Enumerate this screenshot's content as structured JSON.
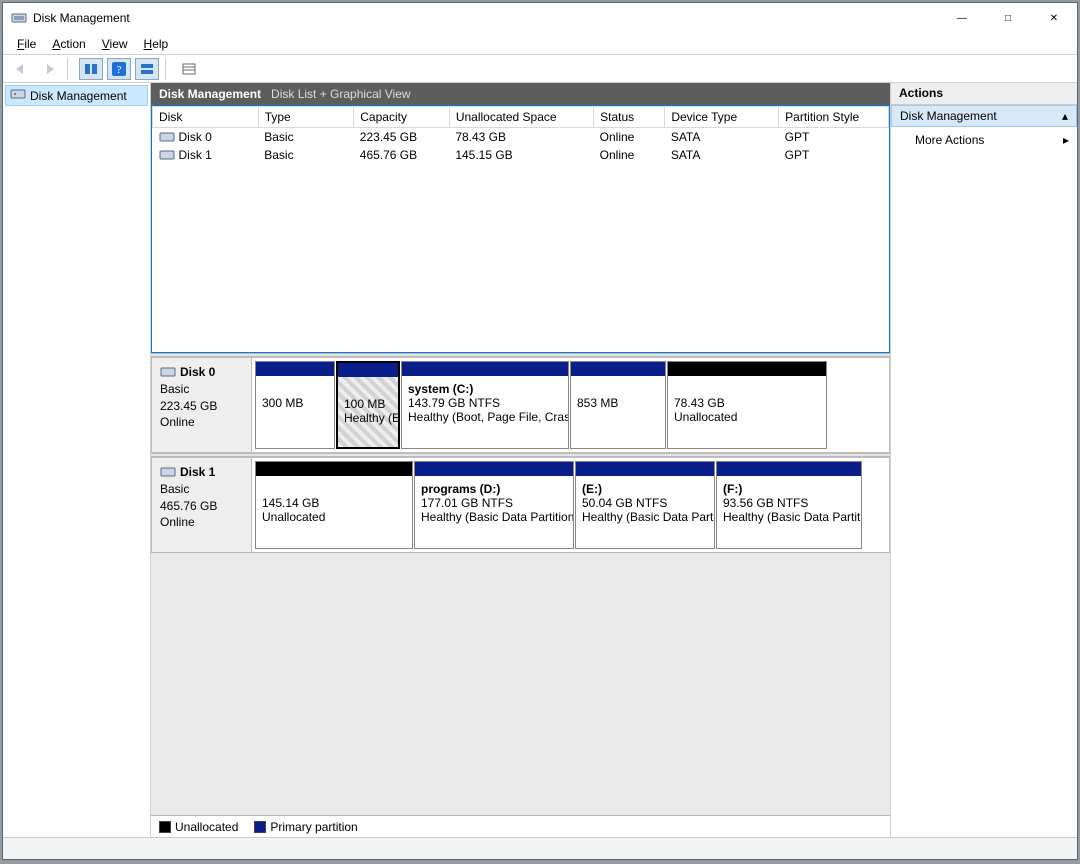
{
  "window": {
    "title": "Disk Management"
  },
  "menus": {
    "file": "File",
    "action": "Action",
    "view": "View",
    "help": "Help"
  },
  "tree": {
    "root": "Disk Management"
  },
  "centerHeader": {
    "title": "Disk Management",
    "subtitle": "Disk List + Graphical View"
  },
  "columns": {
    "disk": "Disk",
    "type": "Type",
    "capacity": "Capacity",
    "unalloc": "Unallocated Space",
    "status": "Status",
    "devtype": "Device Type",
    "partstyle": "Partition Style"
  },
  "disks": [
    {
      "name": "Disk 0",
      "type": "Basic",
      "capacity": "223.45 GB",
      "unalloc": "78.43 GB",
      "status": "Online",
      "devtype": "SATA",
      "partstyle": "GPT"
    },
    {
      "name": "Disk 1",
      "type": "Basic",
      "capacity": "465.76 GB",
      "unalloc": "145.15 GB",
      "status": "Online",
      "devtype": "SATA",
      "partstyle": "GPT"
    }
  ],
  "graph": {
    "disk0": {
      "name": "Disk 0",
      "type": "Basic",
      "capacity": "223.45 GB",
      "status": "Online",
      "parts": [
        {
          "size": "300 MB",
          "bar": "primary"
        },
        {
          "size": "100 MB",
          "health": "Healthy (EFI System Partition)",
          "bar": "primary",
          "hatched": true,
          "selected": true
        },
        {
          "name": "system  (C:)",
          "fs": "143.79 GB NTFS",
          "health": "Healthy (Boot, Page File, Crash Dump, Basic Data Partition)",
          "bar": "primary"
        },
        {
          "size": "853 MB",
          "bar": "primary"
        },
        {
          "size": "78.43 GB",
          "health": "Unallocated",
          "bar": "black"
        }
      ]
    },
    "disk1": {
      "name": "Disk 1",
      "type": "Basic",
      "capacity": "465.76 GB",
      "status": "Online",
      "parts": [
        {
          "size": "145.14 GB",
          "health": "Unallocated",
          "bar": "black"
        },
        {
          "name": "programs  (D:)",
          "fs": "177.01 GB NTFS",
          "health": "Healthy (Basic Data Partition)",
          "bar": "primary"
        },
        {
          "name": "(E:)",
          "fs": "50.04 GB NTFS",
          "health": "Healthy (Basic Data Partition)",
          "bar": "primary"
        },
        {
          "name": "(F:)",
          "fs": "93.56 GB NTFS",
          "health": "Healthy (Basic Data Partition)",
          "bar": "primary"
        }
      ]
    }
  },
  "legend": {
    "unallocated": "Unallocated",
    "primary": "Primary partition"
  },
  "actions": {
    "header": "Actions",
    "group": "Disk Management",
    "more": "More Actions"
  }
}
